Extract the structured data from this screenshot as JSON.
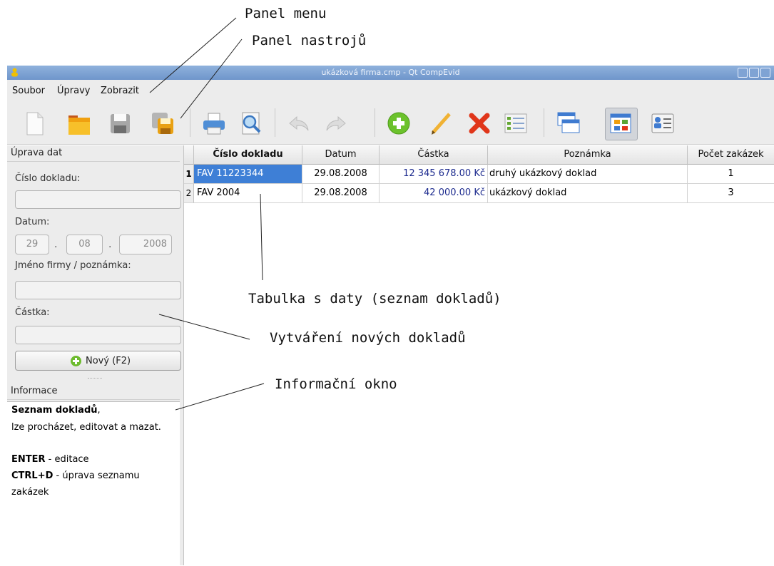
{
  "annotations": {
    "panel_menu": "Panel menu",
    "panel_tools": "Panel nastrojů",
    "table": "Tabulka s daty (seznam dokladů)",
    "create": "Vytváření nových dokladů",
    "info": "Informační okno"
  },
  "window": {
    "title": "ukázková firma.cmp - Qt CompEvid"
  },
  "menu": {
    "file": "Soubor",
    "edit": "Úpravy",
    "view": "Zobrazit"
  },
  "toolbar": {
    "icons": [
      "new-file-icon",
      "open-folder-icon",
      "save-icon",
      "save-as-icon",
      "print-icon",
      "print-preview-icon",
      "undo-icon",
      "redo-icon",
      "add-icon",
      "edit-pencil-icon",
      "delete-icon",
      "list-checks-icon",
      "windows-icon",
      "grid-view-icon",
      "contacts-icon"
    ],
    "active": "grid-view-icon"
  },
  "edit_panel": {
    "title": "Úprava dat",
    "doc_number_label": "Číslo dokladu:",
    "doc_number_value": "",
    "date_label": "Datum:",
    "date_day": "29",
    "date_month": "08",
    "date_year": "2008",
    "company_label": "Jméno firmy / poznámka:",
    "company_value": "",
    "amount_label": "Částka:",
    "amount_value": "",
    "new_button": "Nový (F2)"
  },
  "info_panel": {
    "title": "Informace",
    "line1_bold": "Seznam dokladů",
    "line1_rest": ",",
    "line2": "lze procházet, editovat a mazat.",
    "enter_key": "ENTER",
    "enter_desc": " - editace",
    "ctrl_key": "CTRL+D",
    "ctrl_desc": " - úprava seznamu",
    "ctrl_desc2": "zakázek"
  },
  "table": {
    "columns": [
      "Číslo dokladu",
      "Datum",
      "Částka",
      "Poznámka",
      "Počet zakázek"
    ],
    "rows": [
      {
        "n": "1",
        "doc": "FAV 11223344",
        "date": "29.08.2008",
        "amount": "12 345 678.00 Kč",
        "note": "druhý ukázkový doklad",
        "count": "1",
        "selected": true
      },
      {
        "n": "2",
        "doc": "FAV 2004",
        "date": "29.08.2008",
        "amount": "42 000.00 Kč",
        "note": "ukázkový doklad",
        "count": "3",
        "selected": false
      }
    ]
  },
  "colors": {
    "selection": "#3e7fd6",
    "amount_text": "#1e2c8f",
    "titlebar": "#7fa3d4"
  }
}
